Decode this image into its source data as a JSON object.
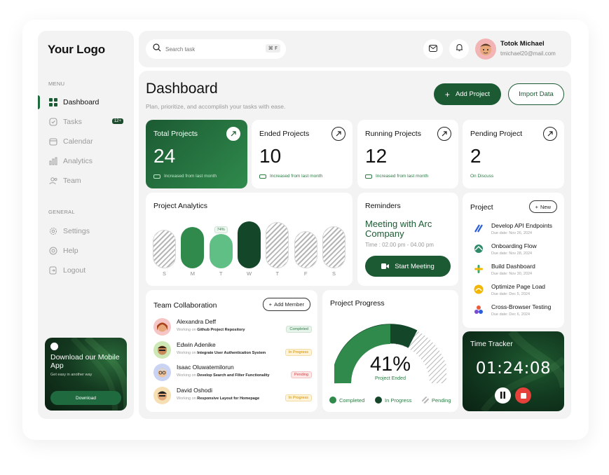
{
  "sidebar": {
    "logo": "Your Logo",
    "menu_title": "MENU",
    "general_title": "GENERAL",
    "menu_items": [
      {
        "label": "Dashboard",
        "icon": "grid-icon",
        "active": true
      },
      {
        "label": "Tasks",
        "icon": "tasks-icon",
        "badge": "12+"
      },
      {
        "label": "Calendar",
        "icon": "calendar-icon"
      },
      {
        "label": "Analytics",
        "icon": "analytics-icon"
      },
      {
        "label": "Team",
        "icon": "team-icon"
      }
    ],
    "general_items": [
      {
        "label": "Settings",
        "icon": "gear-icon"
      },
      {
        "label": "Help",
        "icon": "help-icon"
      },
      {
        "label": "Logout",
        "icon": "logout-icon"
      }
    ],
    "promo": {
      "title": "Download our Mobile App",
      "subtitle": "Get easy in another way",
      "button": "Download"
    }
  },
  "topbar": {
    "search_placeholder": "Search task",
    "search_shortcut": "⌘ F",
    "user_name": "Totok Michael",
    "user_email": "tmichael20@mail.com"
  },
  "header": {
    "title": "Dashboard",
    "subtitle": "Plan, prioritize, and accomplish your tasks with ease.",
    "add_project": "Add Project",
    "import_data": "Import Data"
  },
  "stats": [
    {
      "title": "Total Projects",
      "value": "24",
      "note": "Increased from last month"
    },
    {
      "title": "Ended Projects",
      "value": "10",
      "note": "Increased from last month"
    },
    {
      "title": "Running Projects",
      "value": "12",
      "note": "Increased from last month"
    },
    {
      "title": "Pending Project",
      "value": "2",
      "note": "On Discuss"
    }
  ],
  "analytics": {
    "title": "Project Analytics",
    "tooltip": "74%",
    "days": [
      "S",
      "M",
      "T",
      "W",
      "T",
      "F",
      "S"
    ],
    "styles": [
      "hatched",
      "solid",
      "light",
      "dark",
      "hatched",
      "hatched",
      "hatched"
    ],
    "levels": [
      0.72,
      0.78,
      0.65,
      0.88,
      0.87,
      0.7,
      0.79
    ]
  },
  "reminders": {
    "title": "Reminders",
    "meeting": "Meeting with Arc Company",
    "time": "Time : 02.00 pm - 04.00 pm",
    "button": "Start Meeting"
  },
  "projects": {
    "title": "Project",
    "new_button": "New",
    "items": [
      {
        "name": "Develop API Endpoints",
        "due": "Due date: Nov 26, 2024",
        "icon": "api-icon",
        "color": "#2b5fd9"
      },
      {
        "name": "Onboarding Flow",
        "due": "Due date: Nov 28, 2024",
        "icon": "flow-icon",
        "color": "#2e8b6a"
      },
      {
        "name": "Build Dashboard",
        "due": "Due date: Nov 30, 2024",
        "icon": "dashboard-icon",
        "color": "#3aa86b"
      },
      {
        "name": "Optimize Page Load",
        "due": "Due date: Dec 5, 2024",
        "icon": "speed-icon",
        "color": "#f2b705"
      },
      {
        "name": "Cross-Browser Testing",
        "due": "Due date: Dec 6, 2024",
        "icon": "browser-icon",
        "color": "#7b4bd6"
      }
    ]
  },
  "team": {
    "title": "Team Collaboration",
    "add_button": "Add Member",
    "working_prefix": "Working on",
    "members": [
      {
        "name": "Alexandra Deff",
        "task": "Github Project Repository",
        "status": "Completed",
        "status_color": "#2d7a45",
        "status_bg": "#e7f4eb",
        "avatar_bg": "#f6c6c6"
      },
      {
        "name": "Edwin Adenike",
        "task": "Integrate User Authentication System",
        "status": "In Progress",
        "status_color": "#c98a00",
        "status_bg": "#fff4d9",
        "avatar_bg": "#cde8b5"
      },
      {
        "name": "Isaac Oluwatemilorun",
        "task": "Develop Search and Filter Functionality",
        "status": "Pending",
        "status_color": "#d14343",
        "status_bg": "#fde6e6",
        "avatar_bg": "#c9d3f3"
      },
      {
        "name": "David Oshodi",
        "task": "Responsive Layout for Homepage",
        "status": "In Progress",
        "status_color": "#c98a00",
        "status_bg": "#fff4d9",
        "avatar_bg": "#f6dfb2"
      }
    ]
  },
  "progress": {
    "title": "Project Progress",
    "value": "41%",
    "label": "Project Ended",
    "percent": 41,
    "legend": [
      "Completed",
      "In Progress",
      "Pending"
    ]
  },
  "timer": {
    "title": "Time Tracker",
    "value": "01:24:08"
  },
  "colors": {
    "primary": "#1c5a33",
    "accent": "#2f8a4c",
    "dark": "#14472a",
    "light": "#5fbf85"
  }
}
